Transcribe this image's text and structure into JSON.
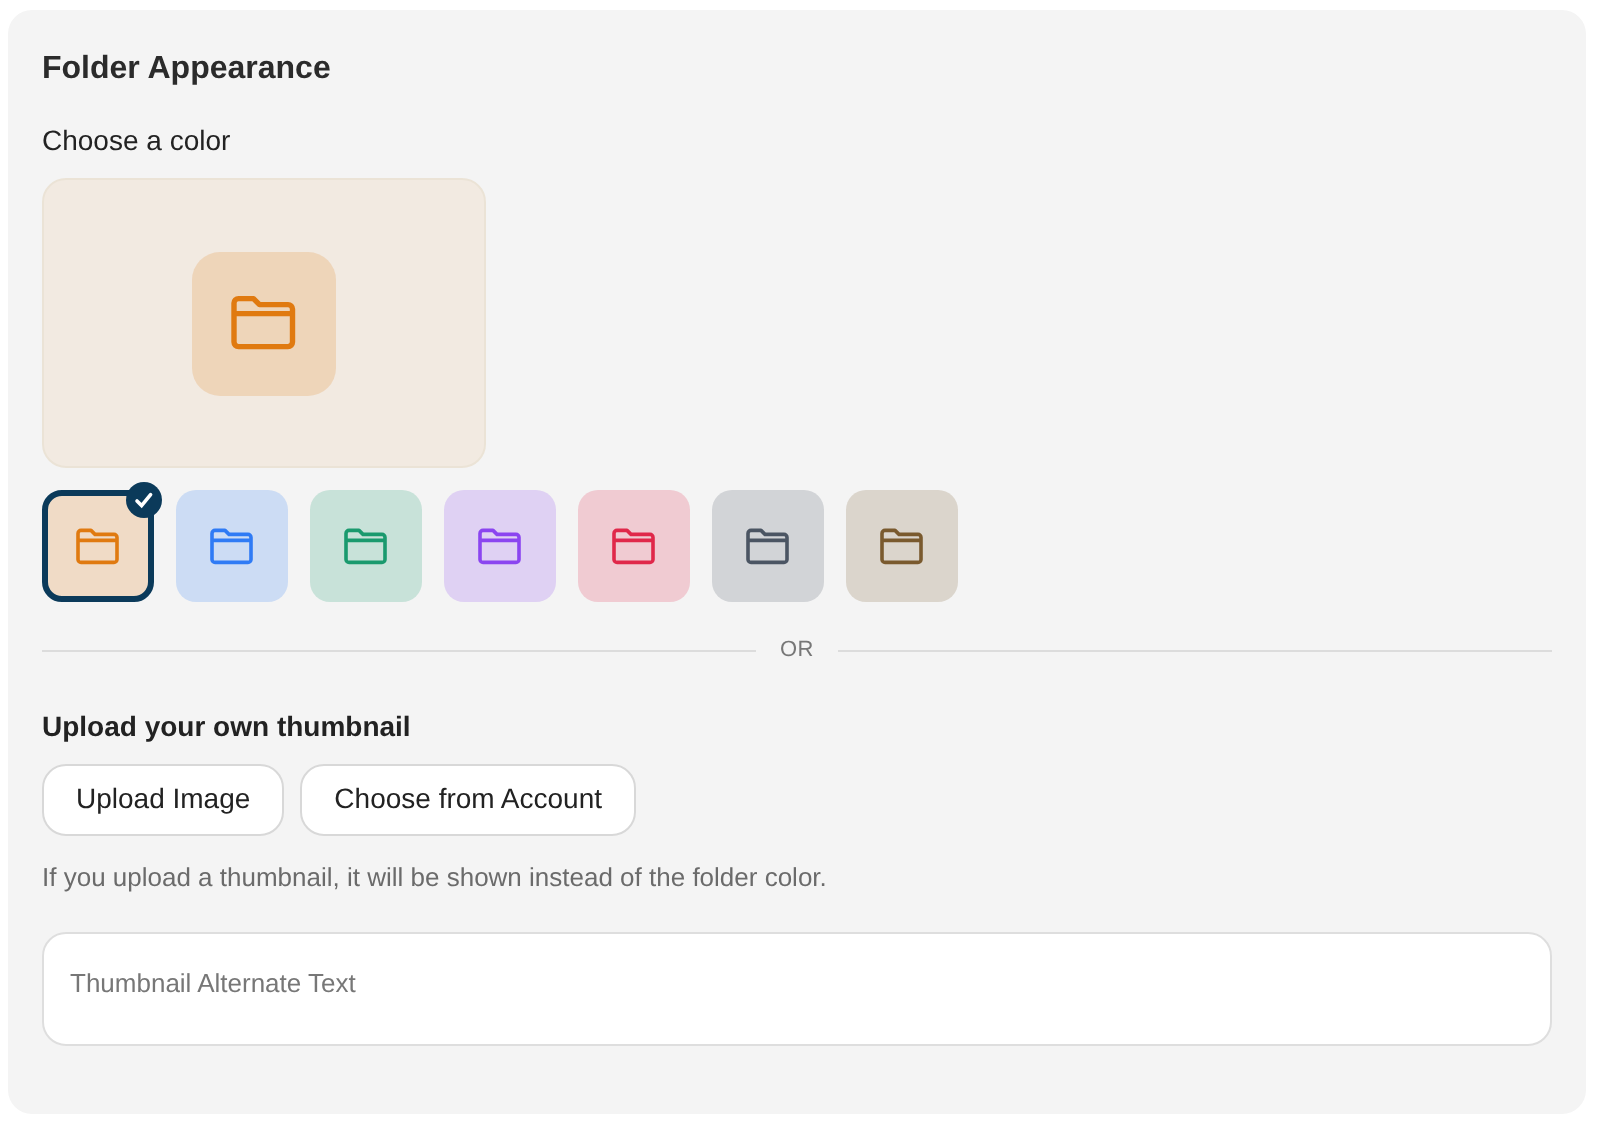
{
  "title": "Folder Appearance",
  "color_label": "Choose a color",
  "swatches": [
    {
      "color": "#e07a10",
      "selected": true
    },
    {
      "color": "#2f7bf5",
      "selected": false
    },
    {
      "color": "#1a9a6e",
      "selected": false
    },
    {
      "color": "#8b45f0",
      "selected": false
    },
    {
      "color": "#e0284a",
      "selected": false
    },
    {
      "color": "#4b5563",
      "selected": false
    },
    {
      "color": "#7a5a2e",
      "selected": false
    }
  ],
  "divider_label": "OR",
  "upload_label": "Upload your own thumbnail",
  "buttons": [
    "Upload Image",
    "Choose from Account"
  ],
  "hint": "If you upload a thumbnail, it will be shown instead of the folder color.",
  "alt_field": {
    "placeholder": "Thumbnail Alternate Text"
  }
}
